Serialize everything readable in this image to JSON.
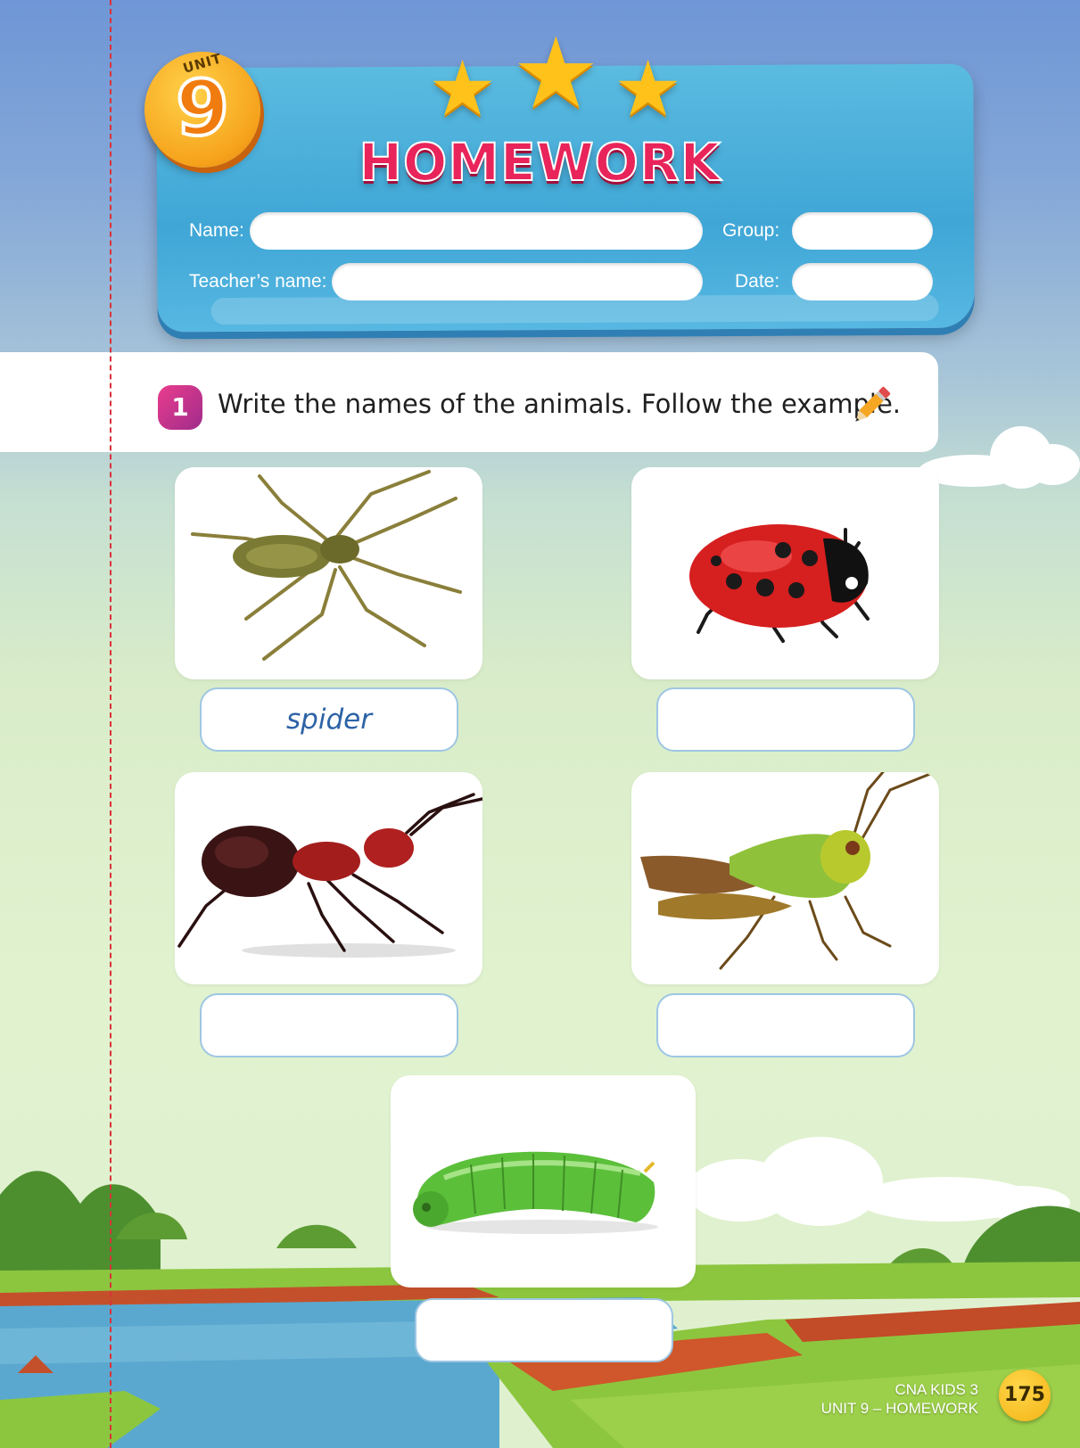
{
  "header": {
    "unit_label": "UNIT",
    "unit_number": "9",
    "title": "HOMEWORK"
  },
  "form": {
    "name_label": "Name:",
    "group_label": "Group:",
    "teacher_label": "Teacher’s name:",
    "date_label": "Date:"
  },
  "exercise": {
    "number": "1",
    "instruction": "Write the names of the animals. Follow the example."
  },
  "items": [
    {
      "picture": "spider",
      "answer": "spider"
    },
    {
      "picture": "ladybug",
      "answer": ""
    },
    {
      "picture": "ant",
      "answer": ""
    },
    {
      "picture": "grasshopper",
      "answer": ""
    },
    {
      "picture": "caterpillar",
      "answer": ""
    }
  ],
  "footer": {
    "book": "CNA KIDS 3",
    "section": "UNIT 9 – HOMEWORK",
    "page": "175"
  },
  "colors": {
    "title_pink": "#e8245a",
    "panel_blue": "#3fa6d6",
    "answer_ink": "#2d63a6",
    "cut_line_red": "#d9323a"
  }
}
